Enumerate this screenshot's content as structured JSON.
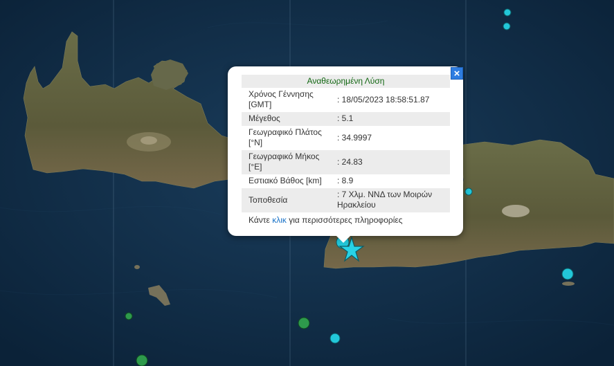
{
  "popup": {
    "title": "Αναθεωρημένη Λύση",
    "rows": [
      {
        "label": "Χρόνος Γέννησης [GMT]",
        "value": ": 18/05/2023 18:58:51.87"
      },
      {
        "label": "Μέγεθος",
        "value": ": 5.1"
      },
      {
        "label": "Γεωγραφικό Πλάτος [°N]",
        "value": ": 34.9997"
      },
      {
        "label": "Γεωγραφικό Μήκος [°E]",
        "value": ": 24.83"
      },
      {
        "label": "Εστιακό Βάθος [km]",
        "value": ": 8.9"
      },
      {
        "label": "Τοποθεσία",
        "value": ": 7 Χλμ. ΝΝΔ των Μοιρών Ηρακλείου"
      }
    ],
    "footer_pre": "Κάντε ",
    "footer_link": "κλικ",
    "footer_post": " για περισσότερες πληροφορίες",
    "close_glyph": "×"
  },
  "map": {
    "sea_color": "#0f2c47",
    "land_color": "#5a5a3c",
    "marker_colors": {
      "cyan": "#22c7d9",
      "green": "#2e9a4c",
      "star": "#28d3e6"
    }
  }
}
